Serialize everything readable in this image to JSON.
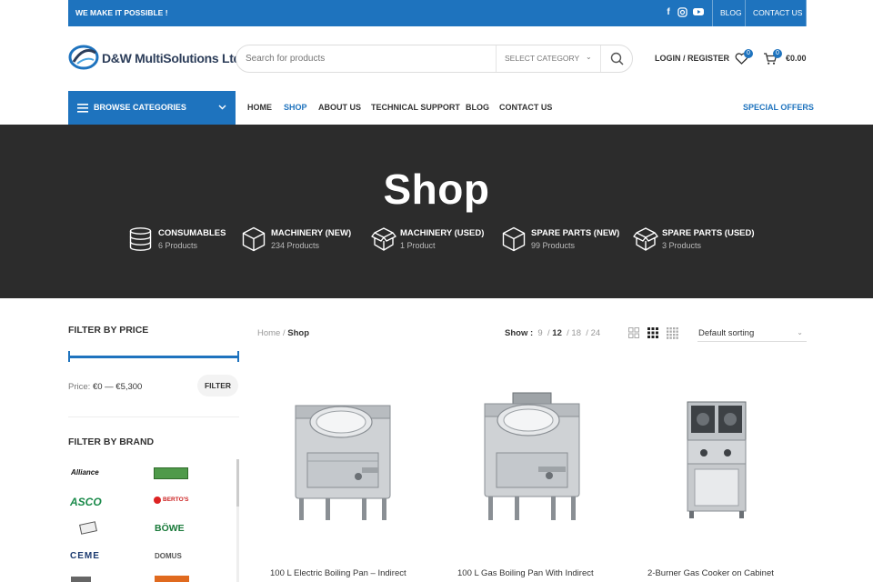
{
  "topbar": {
    "message": "WE MAKE IT POSSIBLE !",
    "social": [
      "facebook-icon",
      "instagram-icon",
      "youtube-icon"
    ],
    "links": [
      "BLOG",
      "CONTACT US"
    ]
  },
  "header": {
    "logo_text": "D&W MultiSolutions Ltd",
    "search_placeholder": "Search for products",
    "category_label": "SELECT CATEGORY",
    "login_label": "LOGIN / REGISTER",
    "wishlist_count": "0",
    "cart_count": "0",
    "cart_total": "€0.00"
  },
  "nav": {
    "browse_label": "BROWSE CATEGORIES",
    "items": [
      "HOME",
      "SHOP",
      "ABOUT US",
      "TECHNICAL SUPPORT",
      "BLOG",
      "CONTACT US"
    ],
    "active": "SHOP",
    "special": "SPECIAL OFFERS"
  },
  "hero": {
    "title": "Shop",
    "categories": [
      {
        "name": "CONSUMABLES",
        "count": "6 Products"
      },
      {
        "name": "MACHINERY (NEW)",
        "count": "234 Products"
      },
      {
        "name": "MACHINERY (USED)",
        "count": "1 Product"
      },
      {
        "name": "SPARE PARTS (NEW)",
        "count": "99 Products"
      },
      {
        "name": "SPARE PARTS (USED)",
        "count": "3 Products"
      }
    ]
  },
  "sidebar": {
    "price_title": "FILTER BY PRICE",
    "price_prefix": "Price:",
    "price_range": "€0 — €5,300",
    "filter_button": "FILTER",
    "brand_title": "FILTER BY BRAND",
    "brands": [
      "Alliance",
      "ASCO",
      "BÖWE",
      "CEME",
      "DOMUS",
      "BERTO'S"
    ]
  },
  "toolbar": {
    "breadcrumb_home": "Home",
    "breadcrumb_current": "Shop",
    "show_label": "Show :",
    "per_page": [
      "9",
      "12",
      "18",
      "24"
    ],
    "per_page_current": "12",
    "sort_label": "Default sorting"
  },
  "products": [
    {
      "title": "100 L Electric Boiling Pan – Indirect"
    },
    {
      "title": "100 L Gas Boiling Pan With Indirect"
    },
    {
      "title": "2-Burner Gas Cooker on Cabinet"
    }
  ],
  "colors": {
    "accent": "#1e73be",
    "hero_bg": "#2c2c2c"
  }
}
